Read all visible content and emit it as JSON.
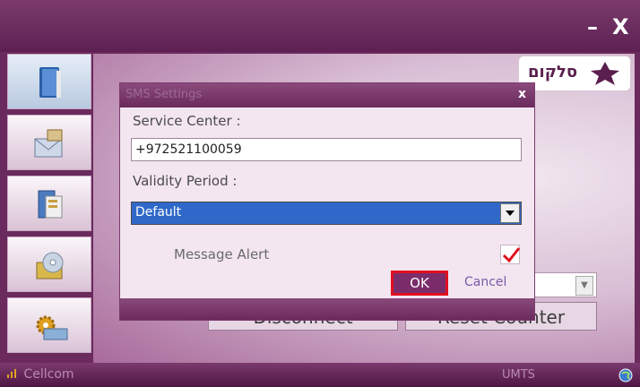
{
  "window": {
    "minimize_label": "–",
    "close_label": "X"
  },
  "brand": {
    "logo_text": "סלקום"
  },
  "sidebar": {
    "items": [
      {
        "name": "sidebar-item-phonebook",
        "icon": "book-icon",
        "active": true
      },
      {
        "name": "sidebar-item-messages",
        "icon": "envelope-card-icon",
        "active": false
      },
      {
        "name": "sidebar-item-contacts",
        "icon": "address-book-icon",
        "active": false
      },
      {
        "name": "sidebar-item-media",
        "icon": "cd-icon",
        "active": false
      },
      {
        "name": "sidebar-item-settings",
        "icon": "gears-icon",
        "active": false
      }
    ]
  },
  "background": {
    "disconnect_label": "Disconnect",
    "reset_counter_label": "Reset Counter"
  },
  "dialog": {
    "title": "SMS Settings",
    "close_label": "x",
    "service_center_label": "Service Center :",
    "service_center_value": "+972521100059",
    "validity_period_label": "Validity Period :",
    "validity_period_value": "Default",
    "message_alert_label": "Message Alert",
    "message_alert_checked": true,
    "ok_label": "OK",
    "cancel_label": "Cancel"
  },
  "statusbar": {
    "operator": "Cellcom",
    "network": "UMTS"
  },
  "colors": {
    "accent": "#6a2a5c",
    "highlight": "#e01020",
    "selection": "#2f68c9"
  }
}
